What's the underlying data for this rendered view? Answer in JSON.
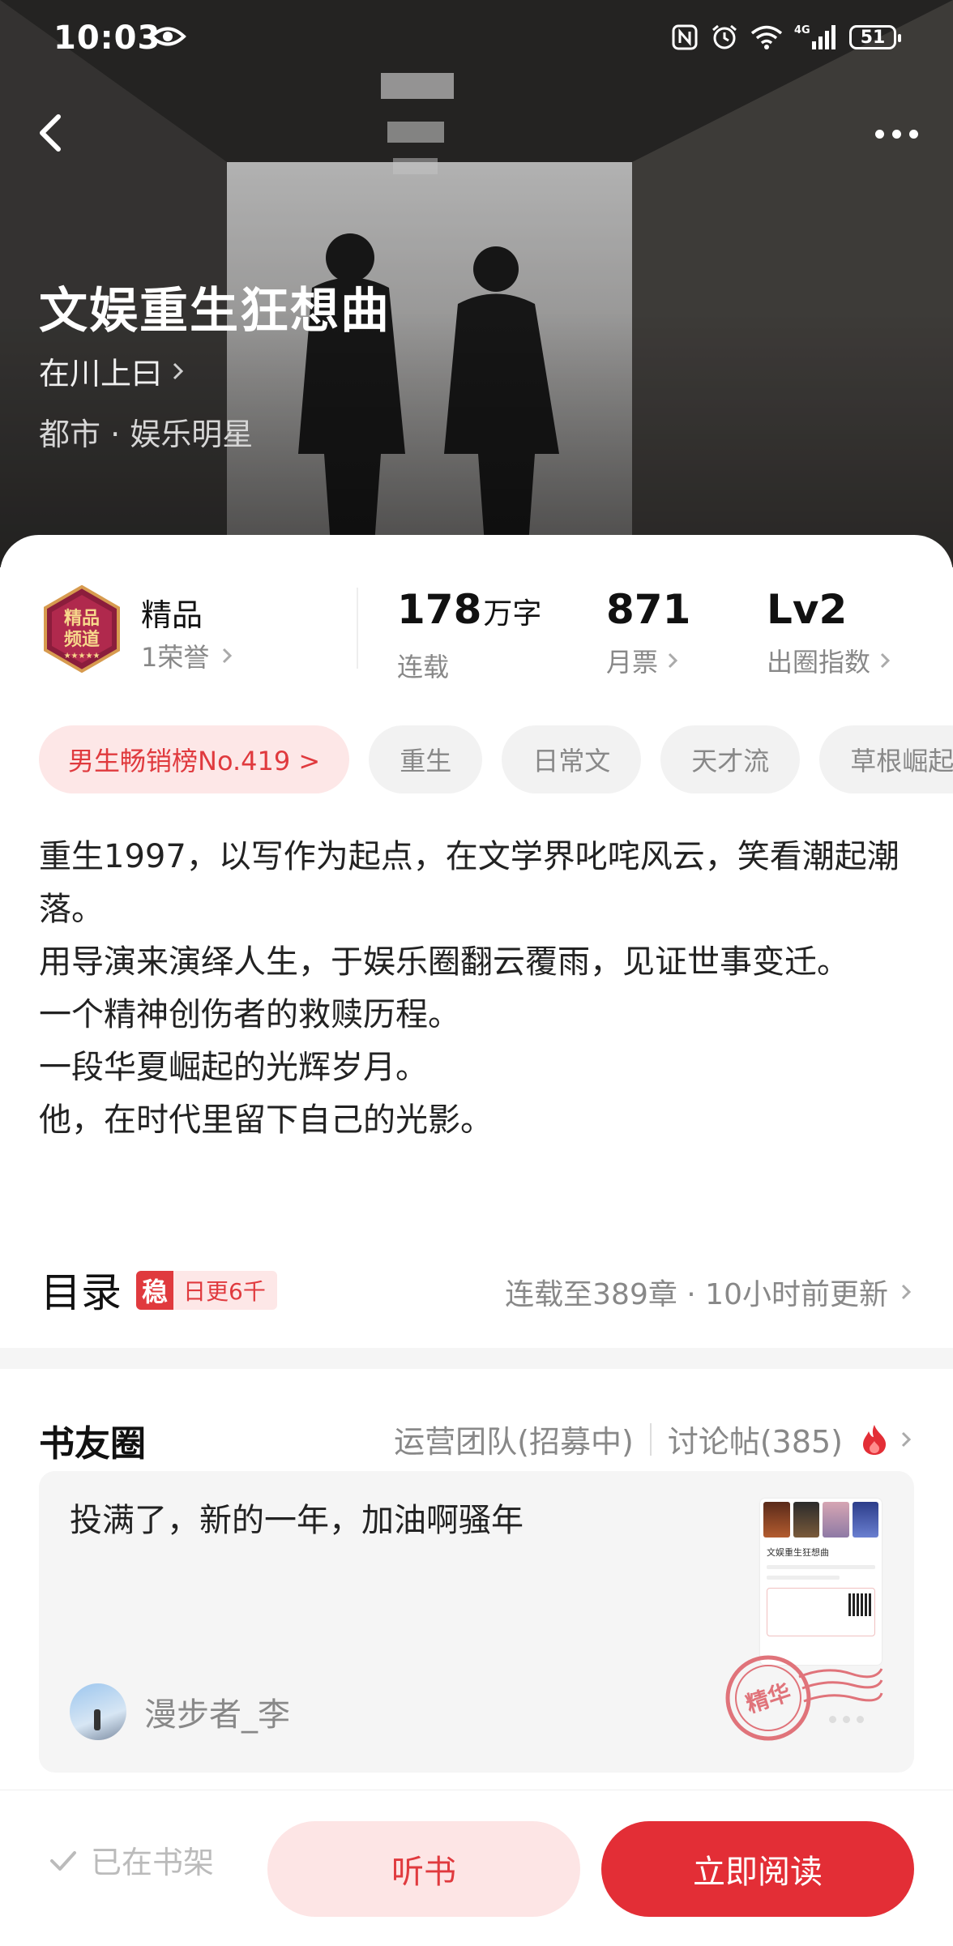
{
  "status_bar": {
    "time": "10:03",
    "network": "4G",
    "battery": "51",
    "icons": [
      "eye-icon",
      "nfc-icon",
      "alarm-icon",
      "wifi-icon",
      "signal-icon",
      "battery-icon"
    ]
  },
  "hero": {
    "title": "文娱重生狂想曲",
    "author": "在川上曰",
    "genre": "都市 · 娱乐明星"
  },
  "honor": {
    "name": "精品",
    "sub": "1荣誉"
  },
  "stats": [
    {
      "value": "178",
      "unit": "万字",
      "label": "连载",
      "has_arrow": false
    },
    {
      "value": "871",
      "unit": "",
      "label": "月票",
      "has_arrow": true
    },
    {
      "value": "Lv2",
      "unit": "",
      "label": "出圈指数",
      "has_arrow": true
    }
  ],
  "tags": [
    "男生畅销榜No.419 >",
    "重生",
    "日常文",
    "天才流",
    "草根崛起"
  ],
  "description": [
    "重生1997，以写作为起点，在文学界叱咤风云，笑看潮起潮落。",
    "用导演来演绎人生，于娱乐圈翻云覆雨，见证世事变迁。",
    "一个精神创伤者的救赎历程。",
    "一段华夏崛起的光辉岁月。",
    "他，在时代里留下自己的光影。"
  ],
  "toc": {
    "title": "目录",
    "badge_stamp": "稳",
    "badge_text": "日更6千",
    "status": "连载至389章 · 10小时前更新"
  },
  "circle": {
    "title": "书友圈",
    "ops_team": "运营团队(招募中)",
    "discussions": "讨论帖(385)",
    "post": {
      "text": "投满了，新的一年，加油啊骚年",
      "username": "漫步者_李",
      "stamp_label": "精华",
      "thumb_title": "文娱重生狂想曲"
    }
  },
  "bottom": {
    "shelf": "已在书架",
    "listen": "听书",
    "read": "立即阅读"
  },
  "colors": {
    "accent": "#e32e36",
    "accent_soft": "#fde5e5",
    "muted": "#888888"
  }
}
